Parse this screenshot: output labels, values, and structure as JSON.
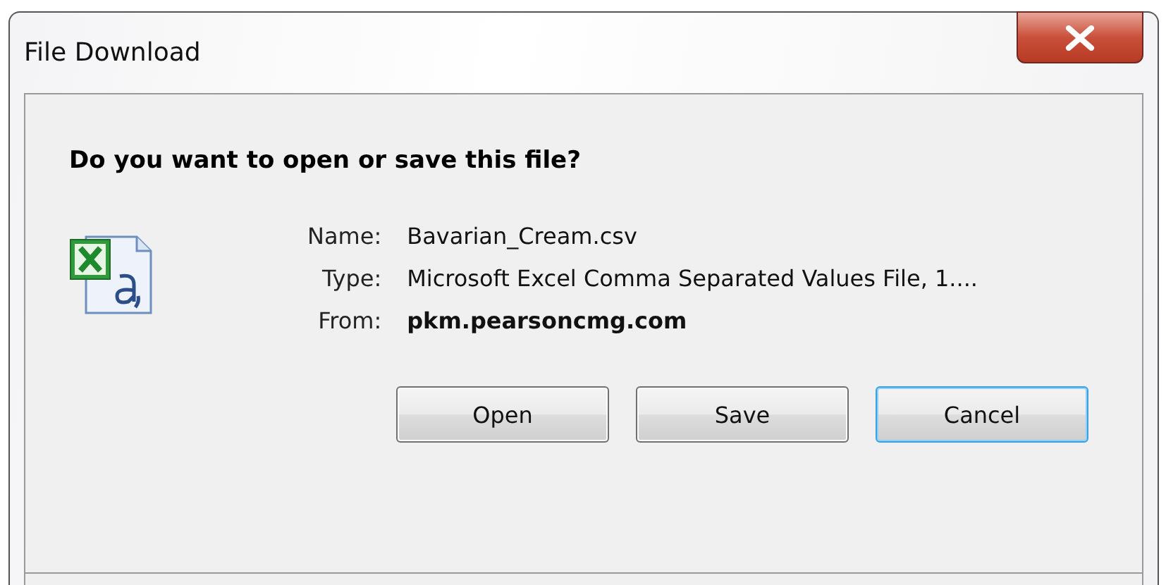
{
  "window": {
    "title": "File Download"
  },
  "question": "Do you want to open or save this file?",
  "details": [
    {
      "label": "Name:",
      "value": "Bavarian_Cream.csv",
      "emphasized": false
    },
    {
      "label": "Type:",
      "value": "Microsoft Excel Comma Separated Values File, 1....",
      "emphasized": false
    },
    {
      "label": "From:",
      "value": "pkm.pearsoncmg.com",
      "emphasized": true
    }
  ],
  "buttons": [
    {
      "label": "Open",
      "focused": false
    },
    {
      "label": "Save",
      "focused": false
    },
    {
      "label": "Cancel",
      "focused": true
    }
  ]
}
